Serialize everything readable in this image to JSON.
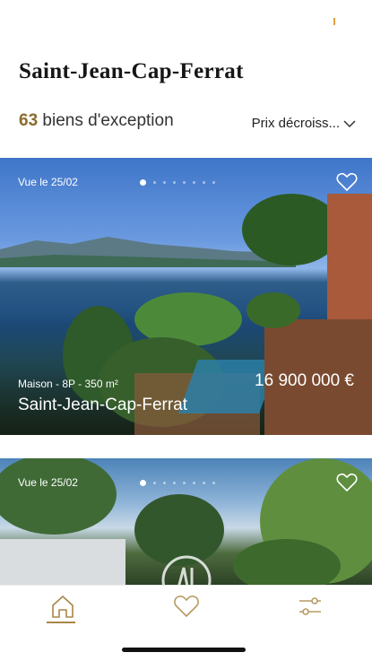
{
  "header": {
    "title": "Saint-Jean-Cap-Ferrat"
  },
  "results": {
    "count": "63",
    "count_label": "biens d'exception"
  },
  "sort": {
    "label": "Prix décroiss..."
  },
  "listings": [
    {
      "viewed": "Vue le 25/02",
      "details": "Maison - 8P - 350 m²",
      "price": "16 900 000 €",
      "city": "Saint-Jean-Cap-Ferrat",
      "photo_count": 8,
      "active_photo": 0
    },
    {
      "viewed": "Vue le 25/02",
      "photo_count": 8,
      "active_photo": 0
    }
  ],
  "tabs": [
    {
      "icon": "home-icon",
      "active": true
    },
    {
      "icon": "heart-icon",
      "active": false
    },
    {
      "icon": "filters-icon",
      "active": false
    }
  ],
  "colors": {
    "accent": "#a88647",
    "count": "#8a6b2e"
  }
}
